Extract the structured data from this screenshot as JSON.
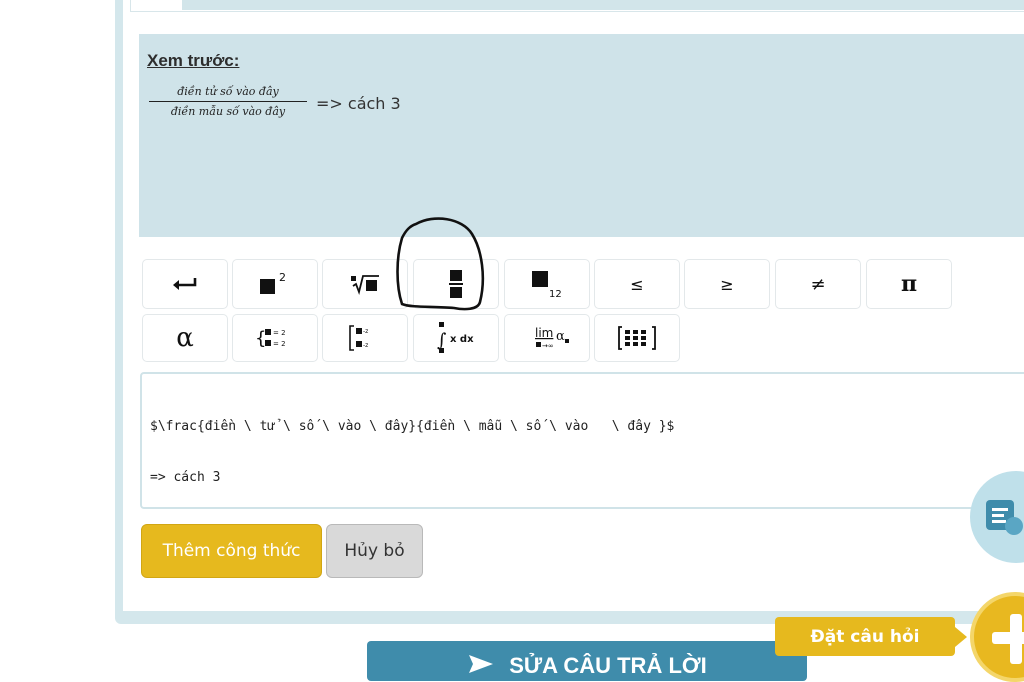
{
  "preview": {
    "title": "Xem trước:",
    "fraction_numerator": "điền tử số vào đây",
    "fraction_denominator": "điền mẫu số vào đây",
    "after_text": "=> cách 3"
  },
  "toolbar": {
    "row1": [
      {
        "name": "enter-icon",
        "glyph": "↵"
      },
      {
        "name": "superscript-icon",
        "glyph": "■²"
      },
      {
        "name": "nth-root-icon",
        "glyph": "ⁿ√■"
      },
      {
        "name": "fraction-icon",
        "glyph": "■/■"
      },
      {
        "name": "subscript-icon",
        "glyph": "■₁₂",
        "sub": "12"
      },
      {
        "name": "less-equal-icon",
        "glyph": "≤"
      },
      {
        "name": "greater-equal-icon",
        "glyph": "≥"
      },
      {
        "name": "not-equal-icon",
        "glyph": "≠"
      },
      {
        "name": "pi-icon",
        "glyph": "π"
      }
    ],
    "row2": [
      {
        "name": "alpha-icon",
        "glyph": "α"
      },
      {
        "name": "system-of-equations-icon",
        "glyph": "{ ■=2 ■=2"
      },
      {
        "name": "bracket-system-icon",
        "glyph": "[ ■-z ■-z"
      },
      {
        "name": "integral-icon",
        "glyph": "∫ x dx"
      },
      {
        "name": "limit-icon",
        "glyph": "lim α",
        "sub": "■→∞"
      },
      {
        "name": "matrix-icon",
        "glyph": "[⠿]"
      }
    ]
  },
  "editor": {
    "line1": "$\\frac{điền \\ tử \\ số \\ vào \\ đây}{điền \\ mẫu \\ số \\ vào   \\ đây }$",
    "line2": "=> cách 3"
  },
  "buttons": {
    "add_formula": "Thêm công thức",
    "cancel": "Hủy bỏ",
    "edit_answer": "SỬA CÂU TRẢ LỜI",
    "ask_question": "Đặt câu hỏi"
  },
  "colors": {
    "accent_yellow": "#e6b91e",
    "panel_blue": "#d4e7ec",
    "primary_blue": "#3f8cab"
  }
}
